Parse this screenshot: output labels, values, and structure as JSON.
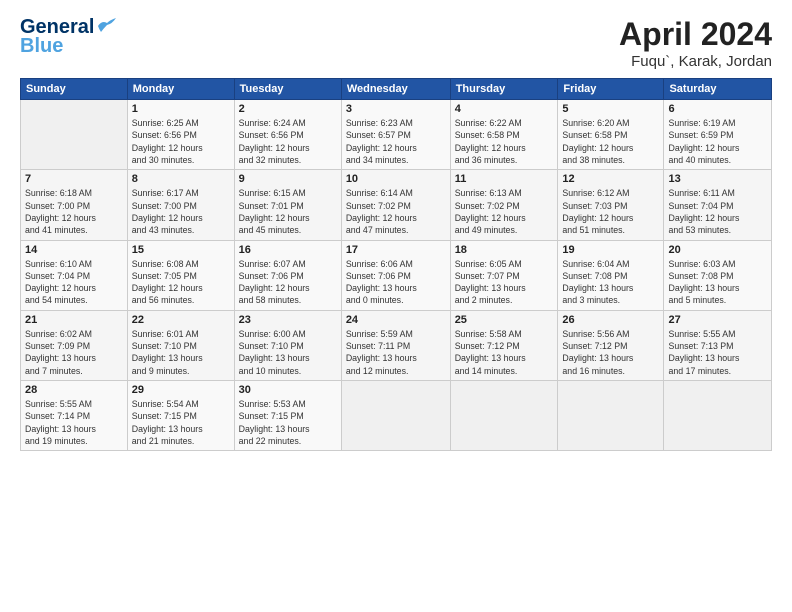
{
  "header": {
    "logo_line1": "General",
    "logo_line2": "Blue",
    "title": "April 2024",
    "location": "Fuqu`, Karak, Jordan"
  },
  "columns": [
    "Sunday",
    "Monday",
    "Tuesday",
    "Wednesday",
    "Thursday",
    "Friday",
    "Saturday"
  ],
  "weeks": [
    [
      {
        "day": "",
        "info": ""
      },
      {
        "day": "1",
        "info": "Sunrise: 6:25 AM\nSunset: 6:56 PM\nDaylight: 12 hours\nand 30 minutes."
      },
      {
        "day": "2",
        "info": "Sunrise: 6:24 AM\nSunset: 6:56 PM\nDaylight: 12 hours\nand 32 minutes."
      },
      {
        "day": "3",
        "info": "Sunrise: 6:23 AM\nSunset: 6:57 PM\nDaylight: 12 hours\nand 34 minutes."
      },
      {
        "day": "4",
        "info": "Sunrise: 6:22 AM\nSunset: 6:58 PM\nDaylight: 12 hours\nand 36 minutes."
      },
      {
        "day": "5",
        "info": "Sunrise: 6:20 AM\nSunset: 6:58 PM\nDaylight: 12 hours\nand 38 minutes."
      },
      {
        "day": "6",
        "info": "Sunrise: 6:19 AM\nSunset: 6:59 PM\nDaylight: 12 hours\nand 40 minutes."
      }
    ],
    [
      {
        "day": "7",
        "info": "Sunrise: 6:18 AM\nSunset: 7:00 PM\nDaylight: 12 hours\nand 41 minutes."
      },
      {
        "day": "8",
        "info": "Sunrise: 6:17 AM\nSunset: 7:00 PM\nDaylight: 12 hours\nand 43 minutes."
      },
      {
        "day": "9",
        "info": "Sunrise: 6:15 AM\nSunset: 7:01 PM\nDaylight: 12 hours\nand 45 minutes."
      },
      {
        "day": "10",
        "info": "Sunrise: 6:14 AM\nSunset: 7:02 PM\nDaylight: 12 hours\nand 47 minutes."
      },
      {
        "day": "11",
        "info": "Sunrise: 6:13 AM\nSunset: 7:02 PM\nDaylight: 12 hours\nand 49 minutes."
      },
      {
        "day": "12",
        "info": "Sunrise: 6:12 AM\nSunset: 7:03 PM\nDaylight: 12 hours\nand 51 minutes."
      },
      {
        "day": "13",
        "info": "Sunrise: 6:11 AM\nSunset: 7:04 PM\nDaylight: 12 hours\nand 53 minutes."
      }
    ],
    [
      {
        "day": "14",
        "info": "Sunrise: 6:10 AM\nSunset: 7:04 PM\nDaylight: 12 hours\nand 54 minutes."
      },
      {
        "day": "15",
        "info": "Sunrise: 6:08 AM\nSunset: 7:05 PM\nDaylight: 12 hours\nand 56 minutes."
      },
      {
        "day": "16",
        "info": "Sunrise: 6:07 AM\nSunset: 7:06 PM\nDaylight: 12 hours\nand 58 minutes."
      },
      {
        "day": "17",
        "info": "Sunrise: 6:06 AM\nSunset: 7:06 PM\nDaylight: 13 hours\nand 0 minutes."
      },
      {
        "day": "18",
        "info": "Sunrise: 6:05 AM\nSunset: 7:07 PM\nDaylight: 13 hours\nand 2 minutes."
      },
      {
        "day": "19",
        "info": "Sunrise: 6:04 AM\nSunset: 7:08 PM\nDaylight: 13 hours\nand 3 minutes."
      },
      {
        "day": "20",
        "info": "Sunrise: 6:03 AM\nSunset: 7:08 PM\nDaylight: 13 hours\nand 5 minutes."
      }
    ],
    [
      {
        "day": "21",
        "info": "Sunrise: 6:02 AM\nSunset: 7:09 PM\nDaylight: 13 hours\nand 7 minutes."
      },
      {
        "day": "22",
        "info": "Sunrise: 6:01 AM\nSunset: 7:10 PM\nDaylight: 13 hours\nand 9 minutes."
      },
      {
        "day": "23",
        "info": "Sunrise: 6:00 AM\nSunset: 7:10 PM\nDaylight: 13 hours\nand 10 minutes."
      },
      {
        "day": "24",
        "info": "Sunrise: 5:59 AM\nSunset: 7:11 PM\nDaylight: 13 hours\nand 12 minutes."
      },
      {
        "day": "25",
        "info": "Sunrise: 5:58 AM\nSunset: 7:12 PM\nDaylight: 13 hours\nand 14 minutes."
      },
      {
        "day": "26",
        "info": "Sunrise: 5:56 AM\nSunset: 7:12 PM\nDaylight: 13 hours\nand 16 minutes."
      },
      {
        "day": "27",
        "info": "Sunrise: 5:55 AM\nSunset: 7:13 PM\nDaylight: 13 hours\nand 17 minutes."
      }
    ],
    [
      {
        "day": "28",
        "info": "Sunrise: 5:55 AM\nSunset: 7:14 PM\nDaylight: 13 hours\nand 19 minutes."
      },
      {
        "day": "29",
        "info": "Sunrise: 5:54 AM\nSunset: 7:15 PM\nDaylight: 13 hours\nand 21 minutes."
      },
      {
        "day": "30",
        "info": "Sunrise: 5:53 AM\nSunset: 7:15 PM\nDaylight: 13 hours\nand 22 minutes."
      },
      {
        "day": "",
        "info": ""
      },
      {
        "day": "",
        "info": ""
      },
      {
        "day": "",
        "info": ""
      },
      {
        "day": "",
        "info": ""
      }
    ]
  ]
}
